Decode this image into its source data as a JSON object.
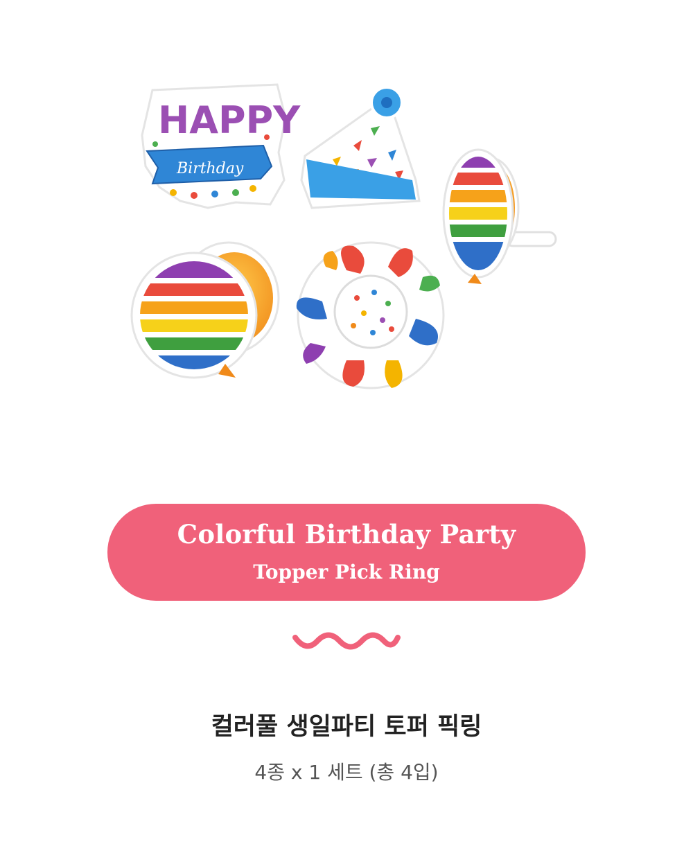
{
  "product_image": {
    "happy_text": "HAPPY",
    "birthday_text": "Birthday"
  },
  "banner": {
    "title": "Colorful Birthday Party",
    "subtitle": "Topper Pick Ring",
    "color": "#f0617a"
  },
  "divider": {
    "icon": "wavy-line-icon",
    "color": "#f0617a"
  },
  "product_info": {
    "name": "컬러풀 생일파티 토퍼 픽링",
    "set_description": "4종 x 1 세트 (총 4입)"
  }
}
